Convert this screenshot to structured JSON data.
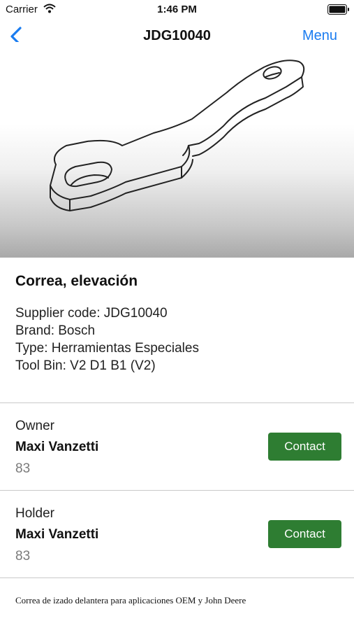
{
  "status_bar": {
    "carrier": "Carrier",
    "time": "1:46 PM"
  },
  "nav": {
    "title": "JDG10040",
    "menu_label": "Menu"
  },
  "tool": {
    "name": "Correa, elevación",
    "supplier_code": "Supplier code: JDG10040",
    "brand": "Brand: Bosch",
    "type": "Type: Herramientas Especiales",
    "tool_bin": "Tool Bin: V2 D1 B1 (V2)"
  },
  "owner": {
    "role": "Owner",
    "name": "Maxi Vanzetti",
    "number": "83",
    "contact_label": "Contact"
  },
  "holder": {
    "role": "Holder",
    "name": "Maxi Vanzetti",
    "number": "83",
    "contact_label": "Contact"
  },
  "description": "Correa de izado delantera para aplicaciones OEM y John Deere",
  "colors": {
    "accent": "#1a7cf0",
    "contact_button": "#2e7d32",
    "secondary_text": "#7a7a7a"
  }
}
